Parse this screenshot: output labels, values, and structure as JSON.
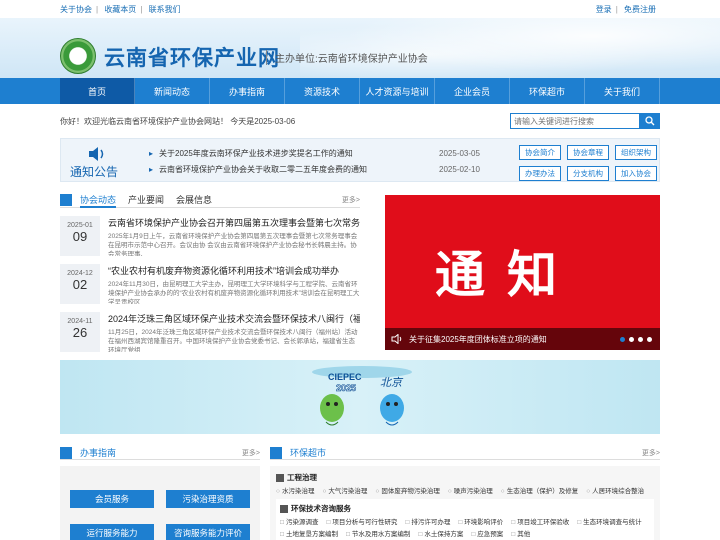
{
  "topbar": {
    "left_links": [
      "关于协会",
      "收藏本页",
      "联系我们"
    ],
    "right_links": [
      "登录",
      "免费注册"
    ]
  },
  "header": {
    "site_title": "云南省环保产业网",
    "host": "主办单位:云南省环境保护产业协会"
  },
  "nav": {
    "items": [
      "首页",
      "新闻动态",
      "办事指南",
      "资源技术",
      "人才资源与培训",
      "企业会员",
      "环保超市",
      "关于我们"
    ],
    "active_index": 0
  },
  "welcome": {
    "text": "你好！欢迎光临云南省环境保护产业协会网站！ 今天是2025-03-06"
  },
  "search": {
    "placeholder": "请输入关键词进行搜索"
  },
  "notice": {
    "label": "通知公告",
    "items": [
      {
        "title": "关于2025年度云南环保产业技术进步奖提名工作的通知",
        "date": "2025-03-05"
      },
      {
        "title": "云南省环境保护产业协会关于收取二零二五年度会费的通知",
        "date": "2025-02-10"
      }
    ],
    "links": [
      "协会简介",
      "协会章程",
      "组织架构",
      "办理办法",
      "分支机构",
      "加入协会"
    ]
  },
  "news": {
    "tabs": [
      "协会动态",
      "产业要闻",
      "会展信息"
    ],
    "more": "更多>",
    "items": [
      {
        "ym": "2025-01",
        "dd": "09",
        "title": "云南省环境保护产业协会召开第四届第五次理事会暨第七次常务理事会",
        "summary": "2025年1月9日上午，云南省环境保护产业协会第四届第五次理事会暨第七次常务理事会在昆明市示范中心召开。会议由协 会议由云南省环境保护产业协会秘书长韩晨主持。协会常务理事、"
      },
      {
        "ym": "2024-12",
        "dd": "02",
        "title": "“农业农村有机废弃物资源化循环利用技术”培训会成功举办",
        "summary": "2024年11月30日，由昆明理工大学主办，昆明理工大学环境科学与工程学院、云南省环境保护产业协会承办的的“农业农村有机废弃物资源化循环利用技术”培训会在昆明理工大学呈贡校区"
      },
      {
        "ym": "2024-11",
        "dd": "26",
        "title": "2024年泛珠三角区域环保产业技术交流会暨环保技术八闽行（福州站...",
        "summary": "11月25日，2024年泛珠三角区域环保产业技术交流会暨环保技术八闽行（福州站）活动在福州西湖宾馆隆重召开。中国环境保护产业协会党委书记、会长郭承站，福建省生态环境厅党组"
      }
    ]
  },
  "slider": {
    "big_text": "通知",
    "caption": "关于征集2025年度团体标准立项的通知",
    "dots": 4,
    "active_dot": 0
  },
  "ad": {
    "brand": "CIEPEC",
    "year": "2025",
    "city": "北京"
  },
  "guide": {
    "title": "办事指南",
    "more": "更多>",
    "buttons": [
      "会员服务",
      "污染治理资质",
      "运行服务能力",
      "咨询服务能力评价"
    ]
  },
  "mart": {
    "title": "环保超市",
    "more": "更多>",
    "categories": [
      {
        "name": "工程治理",
        "items": [
          "水污染治理",
          "大气污染治理",
          "固体废弃物污染治理",
          "噪声污染治理",
          "生态治理（保护）及修复",
          "人居环境综合整治"
        ]
      },
      {
        "name": "环保技术咨询服务",
        "items": [
          "污染源调查",
          "项目分析与可行性研究",
          "排污许可办理",
          "环境影响评价",
          "项目竣工环保验收",
          "生态环境调查与统计",
          "土地复垦方案编制",
          "节水及用水方案编制",
          "水土保持方案",
          "应急预案",
          "其他"
        ]
      }
    ]
  },
  "colors": {
    "brand_blue": "#1e7fd0",
    "slider_red": "#e00d1a"
  }
}
